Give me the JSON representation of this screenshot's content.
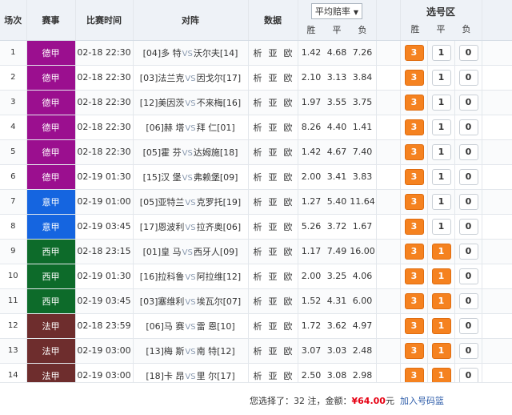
{
  "headers": {
    "index": "场次",
    "league": "赛事",
    "time": "比赛时间",
    "match": "对阵",
    "data": "数据",
    "odds_select": "平均赔率",
    "odds_win": "胜",
    "odds_draw": "平",
    "odds_lose": "负",
    "pick": "选号区",
    "pick_win": "胜",
    "pick_draw": "平",
    "pick_lose": "负"
  },
  "vs_label": "VS",
  "links": [
    "析",
    "亚",
    "欧"
  ],
  "buttons": [
    "3",
    "1",
    "0"
  ],
  "colors": {
    "德甲": "#9b0f8f",
    "意甲": "#1565e0",
    "西甲": "#0d6b2a",
    "法甲": "#6e2d2d",
    "selected": "#f58220"
  },
  "matches": [
    {
      "idx": "1",
      "league": "德甲",
      "time": "02-18 22:30",
      "home": "[04]多 特",
      "away": "沃尔夫[14]",
      "win": "1.42",
      "draw": "4.68",
      "lose": "7.26",
      "picks": [
        true,
        false,
        false
      ]
    },
    {
      "idx": "2",
      "league": "德甲",
      "time": "02-18 22:30",
      "home": "[03]法兰克",
      "away": "因戈尔[17]",
      "win": "2.10",
      "draw": "3.13",
      "lose": "3.84",
      "picks": [
        true,
        false,
        false
      ]
    },
    {
      "idx": "3",
      "league": "德甲",
      "time": "02-18 22:30",
      "home": "[12]美因茨",
      "away": "不来梅[16]",
      "win": "1.97",
      "draw": "3.55",
      "lose": "3.75",
      "picks": [
        true,
        false,
        false
      ]
    },
    {
      "idx": "4",
      "league": "德甲",
      "time": "02-18 22:30",
      "home": "[06]赫 塔",
      "away": "拜 仁[01]",
      "win": "8.26",
      "draw": "4.40",
      "lose": "1.41",
      "picks": [
        true,
        false,
        false
      ]
    },
    {
      "idx": "5",
      "league": "德甲",
      "time": "02-18 22:30",
      "home": "[05]霍 芬",
      "away": "达姆施[18]",
      "win": "1.42",
      "draw": "4.67",
      "lose": "7.40",
      "picks": [
        true,
        false,
        false
      ]
    },
    {
      "idx": "6",
      "league": "德甲",
      "time": "02-19 01:30",
      "home": "[15]汉 堡",
      "away": "弗赖堡[09]",
      "win": "2.00",
      "draw": "3.41",
      "lose": "3.83",
      "picks": [
        true,
        false,
        false
      ]
    },
    {
      "idx": "7",
      "league": "意甲",
      "time": "02-19 01:00",
      "home": "[05]亚特兰",
      "away": "克罗托[19]",
      "win": "1.27",
      "draw": "5.40",
      "lose": "11.64",
      "picks": [
        true,
        false,
        false
      ]
    },
    {
      "idx": "8",
      "league": "意甲",
      "time": "02-19 03:45",
      "home": "[17]恩波利",
      "away": "拉齐奥[06]",
      "win": "5.26",
      "draw": "3.72",
      "lose": "1.67",
      "picks": [
        true,
        false,
        false
      ]
    },
    {
      "idx": "9",
      "league": "西甲",
      "time": "02-18 23:15",
      "home": "[01]皇 马",
      "away": "西牙人[09]",
      "win": "1.17",
      "draw": "7.49",
      "lose": "16.00",
      "picks": [
        true,
        true,
        false
      ]
    },
    {
      "idx": "10",
      "league": "西甲",
      "time": "02-19 01:30",
      "home": "[16]拉科鲁",
      "away": "阿拉维[12]",
      "win": "2.00",
      "draw": "3.25",
      "lose": "4.06",
      "picks": [
        true,
        true,
        false
      ]
    },
    {
      "idx": "11",
      "league": "西甲",
      "time": "02-19 03:45",
      "home": "[03]塞维利",
      "away": "埃瓦尔[07]",
      "win": "1.52",
      "draw": "4.31",
      "lose": "6.00",
      "picks": [
        true,
        true,
        false
      ]
    },
    {
      "idx": "12",
      "league": "法甲",
      "time": "02-18 23:59",
      "home": "[06]马 赛",
      "away": "雷 恩[10]",
      "win": "1.72",
      "draw": "3.62",
      "lose": "4.97",
      "picks": [
        true,
        true,
        false
      ]
    },
    {
      "idx": "13",
      "league": "法甲",
      "time": "02-19 03:00",
      "home": "[13]梅 斯",
      "away": "南 特[12]",
      "win": "3.07",
      "draw": "3.03",
      "lose": "2.48",
      "picks": [
        true,
        true,
        false
      ]
    },
    {
      "idx": "14",
      "league": "法甲",
      "time": "02-19 03:00",
      "home": "[18]卡 昂",
      "away": "里 尔[17]",
      "win": "2.50",
      "draw": "3.08",
      "lose": "2.98",
      "picks": [
        true,
        true,
        false
      ]
    }
  ],
  "footer": {
    "selected_prefix": "您选择了：",
    "count": "32",
    "count_suffix": " 注，金额：",
    "amount": "¥64.00",
    "currency": "元",
    "add_button": "加入号码篮"
  }
}
